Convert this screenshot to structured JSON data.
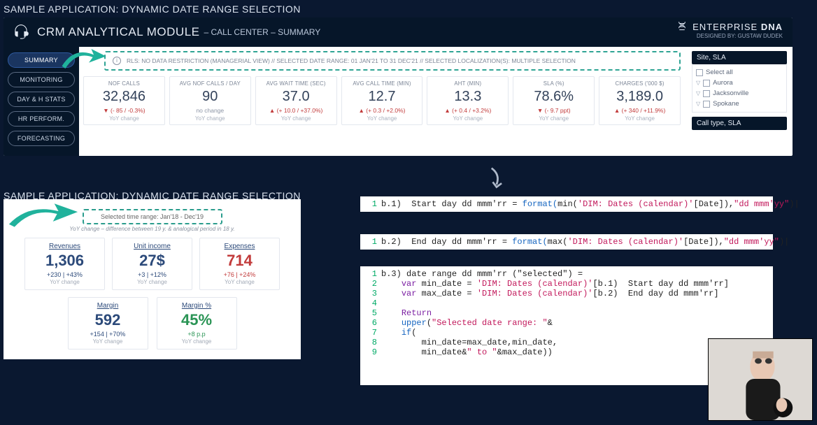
{
  "section_title_top": "SAMPLE APPLICATION: DYNAMIC DATE RANGE SELECTION",
  "section_title_bottom": "SAMPLE APPLICATION: DYNAMIC DATE RANGE SELECTION",
  "crm": {
    "title": "CRM ANALYTICAL MODULE",
    "subtitle": "– CALL CENTER – SUMMARY",
    "brand": "ENTERPRISE ",
    "brand_b": "DNA",
    "designed": "DESIGNED BY: GUSTAW DUDEK"
  },
  "nav": [
    "SUMMARY",
    "MONITORING",
    "DAY & H STATS",
    "HR PERFORM.",
    "FORECASTING"
  ],
  "rls": "RLS: NO DATA RESTRICTION (MANAGERIAL VIEW)   //   SELECTED DATE RANGE: 01 JAN'21 TO 31 DEC'21   //   SELECTED LOCALIZATION(S): MULTIPLE SELECTION",
  "kpis": [
    {
      "label": "NOF CALLS",
      "value": "32,846",
      "delta": "▼ (- 85 / -0.3%)",
      "cls": "red",
      "yoy": "YoY change"
    },
    {
      "label": "AVG NOF CALLS / DAY",
      "value": "90",
      "delta": "no change",
      "cls": "gray",
      "yoy": "YoY change"
    },
    {
      "label": "AVG WAIT TIME (SEC)",
      "value": "37.0",
      "delta": "▲ (+ 10.0 / +37.0%)",
      "cls": "red",
      "yoy": "YoY change"
    },
    {
      "label": "AVG CALL TIME (MIN)",
      "value": "12.7",
      "delta": "▲ (+ 0.3 / +2.0%)",
      "cls": "red",
      "yoy": "YoY change"
    },
    {
      "label": "AHT (MIN)",
      "value": "13.3",
      "delta": "▲ (+ 0.4 / +3.2%)",
      "cls": "red",
      "yoy": "YoY change"
    },
    {
      "label": "SLA (%)",
      "value": "78.6%",
      "delta": "▼ (- 9.7 ppt)",
      "cls": "red",
      "yoy": "YoY change"
    },
    {
      "label": "CHARGES ('000 $)",
      "value": "3,189.0",
      "delta": "▲ (+ 340 / +11.9%)",
      "cls": "red",
      "yoy": "YoY change"
    }
  ],
  "slicer1": {
    "title": "Site, SLA",
    "all": "Select all",
    "items": [
      "Aurora",
      "Jacksonville",
      "Spokane"
    ]
  },
  "slicer2": {
    "title": "Call type, SLA"
  },
  "app2": {
    "selected": "Selected time range:  Jan'18 - Dec'19",
    "note": "YoY change – difference between 19 y. & analogical period in 18 y.",
    "row1": [
      {
        "lbl": "Revenues",
        "big": "1,306",
        "delta": "+230 | +43%",
        "cls": "blue",
        "yoy": "YoY change"
      },
      {
        "lbl": "Unit income",
        "big": "27$",
        "delta": "+3 | +12%",
        "cls": "blue",
        "yoy": "YoY change"
      },
      {
        "lbl": "Expenses",
        "big": "714",
        "delta": "+76 | +24%",
        "cls": "red2",
        "yoy": "YoY change"
      }
    ],
    "row2": [
      {
        "lbl": "Margin",
        "big": "592",
        "delta": "+154 | +70%",
        "cls": "blue",
        "yoy": "YoY change"
      },
      {
        "lbl": "Margin %",
        "big": "45%",
        "delta": "+8 p.p",
        "cls": "green2",
        "yoy": "YoY change"
      }
    ]
  },
  "code1": {
    "ln": "1",
    "pre": "b.1)  Start day dd mmm'rr = ",
    "fn": "format(",
    "mid": "min(",
    "str1": "'DIM: Dates (calendar)'",
    "mid2": "[Date]),",
    "str2": "\"dd mmm'yy\"",
    "end": ")"
  },
  "code2": {
    "ln": "1",
    "pre": "b.2)  End day dd mmm'rr = ",
    "fn": "format(",
    "mid": "max(",
    "str1": "'DIM: Dates (calendar)'",
    "mid2": "[Date]),",
    "str2": "\"dd mmm'yy\"",
    "end": ")"
  },
  "code3": [
    "b.3) date range dd mmm'rr (\"selected\") =",
    "    var min_date = 'DIM: Dates (calendar)'[b.1)  Start day dd mmm'rr]",
    "    var max_date = 'DIM: Dates (calendar)'[b.2)  End day dd mmm'rr]",
    "",
    "    Return",
    "    upper(\"Selected date range: \"&",
    "    if(",
    "        min_date=max_date,min_date,",
    "        min_date&\" to \"&max_date))"
  ]
}
